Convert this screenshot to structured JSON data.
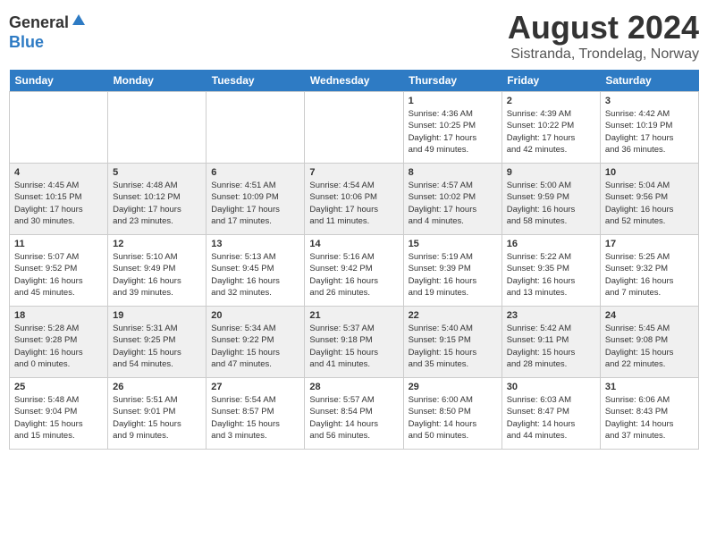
{
  "header": {
    "logo_general": "General",
    "logo_blue": "Blue",
    "month_year": "August 2024",
    "location": "Sistranda, Trondelag, Norway"
  },
  "days_of_week": [
    "Sunday",
    "Monday",
    "Tuesday",
    "Wednesday",
    "Thursday",
    "Friday",
    "Saturday"
  ],
  "weeks": [
    [
      {
        "day": "",
        "info": ""
      },
      {
        "day": "",
        "info": ""
      },
      {
        "day": "",
        "info": ""
      },
      {
        "day": "",
        "info": ""
      },
      {
        "day": "1",
        "info": "Sunrise: 4:36 AM\nSunset: 10:25 PM\nDaylight: 17 hours\nand 49 minutes."
      },
      {
        "day": "2",
        "info": "Sunrise: 4:39 AM\nSunset: 10:22 PM\nDaylight: 17 hours\nand 42 minutes."
      },
      {
        "day": "3",
        "info": "Sunrise: 4:42 AM\nSunset: 10:19 PM\nDaylight: 17 hours\nand 36 minutes."
      }
    ],
    [
      {
        "day": "4",
        "info": "Sunrise: 4:45 AM\nSunset: 10:15 PM\nDaylight: 17 hours\nand 30 minutes."
      },
      {
        "day": "5",
        "info": "Sunrise: 4:48 AM\nSunset: 10:12 PM\nDaylight: 17 hours\nand 23 minutes."
      },
      {
        "day": "6",
        "info": "Sunrise: 4:51 AM\nSunset: 10:09 PM\nDaylight: 17 hours\nand 17 minutes."
      },
      {
        "day": "7",
        "info": "Sunrise: 4:54 AM\nSunset: 10:06 PM\nDaylight: 17 hours\nand 11 minutes."
      },
      {
        "day": "8",
        "info": "Sunrise: 4:57 AM\nSunset: 10:02 PM\nDaylight: 17 hours\nand 4 minutes."
      },
      {
        "day": "9",
        "info": "Sunrise: 5:00 AM\nSunset: 9:59 PM\nDaylight: 16 hours\nand 58 minutes."
      },
      {
        "day": "10",
        "info": "Sunrise: 5:04 AM\nSunset: 9:56 PM\nDaylight: 16 hours\nand 52 minutes."
      }
    ],
    [
      {
        "day": "11",
        "info": "Sunrise: 5:07 AM\nSunset: 9:52 PM\nDaylight: 16 hours\nand 45 minutes."
      },
      {
        "day": "12",
        "info": "Sunrise: 5:10 AM\nSunset: 9:49 PM\nDaylight: 16 hours\nand 39 minutes."
      },
      {
        "day": "13",
        "info": "Sunrise: 5:13 AM\nSunset: 9:45 PM\nDaylight: 16 hours\nand 32 minutes."
      },
      {
        "day": "14",
        "info": "Sunrise: 5:16 AM\nSunset: 9:42 PM\nDaylight: 16 hours\nand 26 minutes."
      },
      {
        "day": "15",
        "info": "Sunrise: 5:19 AM\nSunset: 9:39 PM\nDaylight: 16 hours\nand 19 minutes."
      },
      {
        "day": "16",
        "info": "Sunrise: 5:22 AM\nSunset: 9:35 PM\nDaylight: 16 hours\nand 13 minutes."
      },
      {
        "day": "17",
        "info": "Sunrise: 5:25 AM\nSunset: 9:32 PM\nDaylight: 16 hours\nand 7 minutes."
      }
    ],
    [
      {
        "day": "18",
        "info": "Sunrise: 5:28 AM\nSunset: 9:28 PM\nDaylight: 16 hours\nand 0 minutes."
      },
      {
        "day": "19",
        "info": "Sunrise: 5:31 AM\nSunset: 9:25 PM\nDaylight: 15 hours\nand 54 minutes."
      },
      {
        "day": "20",
        "info": "Sunrise: 5:34 AM\nSunset: 9:22 PM\nDaylight: 15 hours\nand 47 minutes."
      },
      {
        "day": "21",
        "info": "Sunrise: 5:37 AM\nSunset: 9:18 PM\nDaylight: 15 hours\nand 41 minutes."
      },
      {
        "day": "22",
        "info": "Sunrise: 5:40 AM\nSunset: 9:15 PM\nDaylight: 15 hours\nand 35 minutes."
      },
      {
        "day": "23",
        "info": "Sunrise: 5:42 AM\nSunset: 9:11 PM\nDaylight: 15 hours\nand 28 minutes."
      },
      {
        "day": "24",
        "info": "Sunrise: 5:45 AM\nSunset: 9:08 PM\nDaylight: 15 hours\nand 22 minutes."
      }
    ],
    [
      {
        "day": "25",
        "info": "Sunrise: 5:48 AM\nSunset: 9:04 PM\nDaylight: 15 hours\nand 15 minutes."
      },
      {
        "day": "26",
        "info": "Sunrise: 5:51 AM\nSunset: 9:01 PM\nDaylight: 15 hours\nand 9 minutes."
      },
      {
        "day": "27",
        "info": "Sunrise: 5:54 AM\nSunset: 8:57 PM\nDaylight: 15 hours\nand 3 minutes."
      },
      {
        "day": "28",
        "info": "Sunrise: 5:57 AM\nSunset: 8:54 PM\nDaylight: 14 hours\nand 56 minutes."
      },
      {
        "day": "29",
        "info": "Sunrise: 6:00 AM\nSunset: 8:50 PM\nDaylight: 14 hours\nand 50 minutes."
      },
      {
        "day": "30",
        "info": "Sunrise: 6:03 AM\nSunset: 8:47 PM\nDaylight: 14 hours\nand 44 minutes."
      },
      {
        "day": "31",
        "info": "Sunrise: 6:06 AM\nSunset: 8:43 PM\nDaylight: 14 hours\nand 37 minutes."
      }
    ]
  ]
}
